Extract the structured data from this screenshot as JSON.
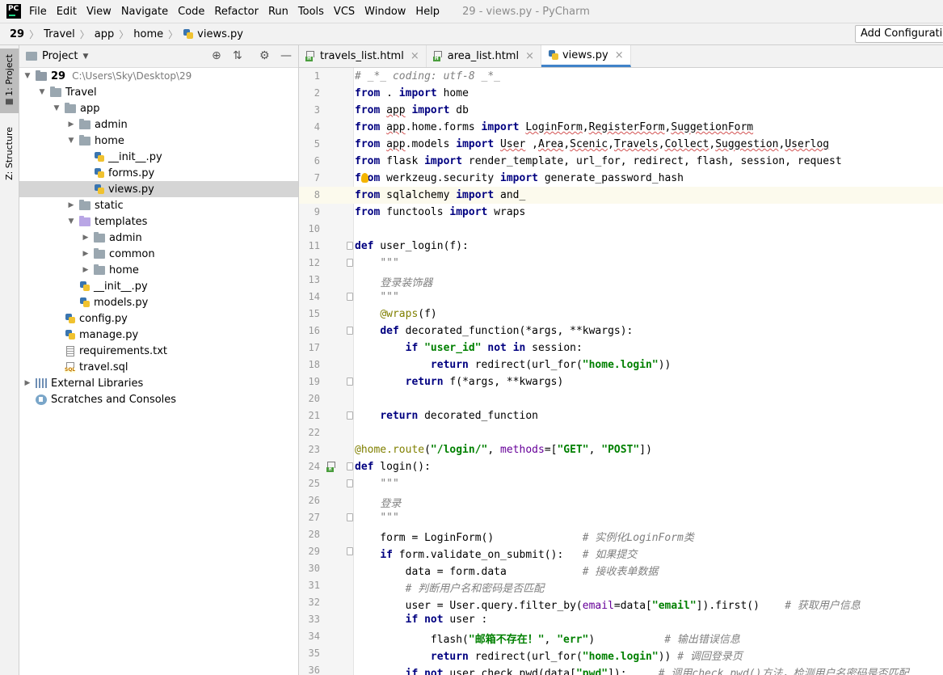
{
  "menubar": {
    "logo": "PC",
    "items": [
      "File",
      "Edit",
      "View",
      "Navigate",
      "Code",
      "Refactor",
      "Run",
      "Tools",
      "VCS",
      "Window",
      "Help"
    ],
    "window_title": "29 - views.py - PyCharm"
  },
  "breadcrumb": {
    "items": [
      "29",
      "Travel",
      "app",
      "home",
      "views.py"
    ],
    "run_config": "Add Configuration..."
  },
  "tool_strip": {
    "project_tab": "1: Project",
    "structure_tab": "Z: Structure"
  },
  "project_panel": {
    "title": "Project",
    "tree": [
      {
        "label": "29",
        "hint": "C:\\Users\\Sky\\Desktop\\29",
        "icon": "folder-icon",
        "arrow": "expanded",
        "depth": 0
      },
      {
        "label": "Travel",
        "icon": "folder-icon",
        "arrow": "expanded",
        "depth": 1
      },
      {
        "label": "app",
        "icon": "folder-icon",
        "arrow": "expanded",
        "depth": 2
      },
      {
        "label": "admin",
        "icon": "folder-icon",
        "arrow": "collapsed",
        "depth": 3
      },
      {
        "label": "home",
        "icon": "folder-icon",
        "arrow": "expanded",
        "depth": 3
      },
      {
        "label": "__init__.py",
        "icon": "python-file-icon",
        "arrow": "none",
        "depth": 4
      },
      {
        "label": "forms.py",
        "icon": "python-file-icon",
        "arrow": "none",
        "depth": 4
      },
      {
        "label": "views.py",
        "icon": "python-file-icon",
        "arrow": "none",
        "depth": 4,
        "selected": true
      },
      {
        "label": "static",
        "icon": "folder-icon",
        "arrow": "collapsed",
        "depth": 3
      },
      {
        "label": "templates",
        "icon": "templates-folder-icon",
        "arrow": "expanded",
        "depth": 3
      },
      {
        "label": "admin",
        "icon": "folder-icon",
        "arrow": "collapsed",
        "depth": 4
      },
      {
        "label": "common",
        "icon": "folder-icon",
        "arrow": "collapsed",
        "depth": 4
      },
      {
        "label": "home",
        "icon": "folder-icon",
        "arrow": "collapsed",
        "depth": 4
      },
      {
        "label": "__init__.py",
        "icon": "python-file-icon",
        "arrow": "none",
        "depth": 3
      },
      {
        "label": "models.py",
        "icon": "python-file-icon",
        "arrow": "none",
        "depth": 3
      },
      {
        "label": "config.py",
        "icon": "python-file-icon",
        "arrow": "none",
        "depth": 2
      },
      {
        "label": "manage.py",
        "icon": "python-file-icon",
        "arrow": "none",
        "depth": 2
      },
      {
        "label": "requirements.txt",
        "icon": "text-file-icon",
        "arrow": "none",
        "depth": 2
      },
      {
        "label": "travel.sql",
        "icon": "sql-file-icon",
        "arrow": "none",
        "depth": 2
      },
      {
        "label": "External Libraries",
        "icon": "libraries-icon",
        "arrow": "collapsed",
        "depth": 0
      },
      {
        "label": "Scratches and Consoles",
        "icon": "scratches-icon",
        "arrow": "none",
        "depth": 0
      }
    ]
  },
  "editor_tabs": [
    {
      "label": "travels_list.html",
      "icon": "html-file-icon",
      "active": false
    },
    {
      "label": "area_list.html",
      "icon": "html-file-icon",
      "active": false
    },
    {
      "label": "views.py",
      "icon": "python-file-icon",
      "active": true
    }
  ],
  "colors": {
    "keyword": "#000080",
    "string": "#008000",
    "comment": "#808080",
    "decorator": "#808000",
    "current_line": "#fcfaed",
    "selection": "#d5d5d5",
    "active_tab_underline": "#4083c9"
  },
  "code_lines": [
    [
      {
        "t": "# _*_ coding: utf-8 _*_",
        "c": "cm"
      }
    ],
    [
      {
        "t": "from",
        "c": "kw"
      },
      {
        "t": " . "
      },
      {
        "t": "import",
        "c": "kw"
      },
      {
        "t": " home"
      }
    ],
    [
      {
        "t": "from",
        "c": "kw"
      },
      {
        "t": " "
      },
      {
        "t": "app",
        "c": "wv"
      },
      {
        "t": " "
      },
      {
        "t": "import",
        "c": "kw"
      },
      {
        "t": " db"
      }
    ],
    [
      {
        "t": "from",
        "c": "kw"
      },
      {
        "t": " "
      },
      {
        "t": "app",
        "c": "wv"
      },
      {
        "t": ".home.forms "
      },
      {
        "t": "import",
        "c": "kw"
      },
      {
        "t": " "
      },
      {
        "t": "LoginForm",
        "c": "wv"
      },
      {
        "t": ","
      },
      {
        "t": "RegisterForm",
        "c": "wv"
      },
      {
        "t": ","
      },
      {
        "t": "SuggetionForm",
        "c": "wv"
      }
    ],
    [
      {
        "t": "from",
        "c": "kw"
      },
      {
        "t": " "
      },
      {
        "t": "app",
        "c": "wv"
      },
      {
        "t": ".models "
      },
      {
        "t": "import",
        "c": "kw"
      },
      {
        "t": " "
      },
      {
        "t": "User",
        "c": "wv"
      },
      {
        "t": " ,"
      },
      {
        "t": "Area",
        "c": "wv"
      },
      {
        "t": ","
      },
      {
        "t": "Scenic",
        "c": "wv"
      },
      {
        "t": ","
      },
      {
        "t": "Travels",
        "c": "wv"
      },
      {
        "t": ","
      },
      {
        "t": "Collect",
        "c": "wv"
      },
      {
        "t": ","
      },
      {
        "t": "Suggestion",
        "c": "wv"
      },
      {
        "t": ","
      },
      {
        "t": "Userlog",
        "c": "wv"
      }
    ],
    [
      {
        "t": "from",
        "c": "kw"
      },
      {
        "t": " flask "
      },
      {
        "t": "import",
        "c": "kw"
      },
      {
        "t": " render_template, url_for, redirect, flash, session, request"
      }
    ],
    [
      {
        "t": "from",
        "c": "kw"
      },
      {
        "t": " werkzeug.security "
      },
      {
        "t": "import",
        "c": "kw"
      },
      {
        "t": " generate_password_hash"
      }
    ],
    [
      {
        "t": "from",
        "c": "kw"
      },
      {
        "t": " sqlalchemy "
      },
      {
        "t": "import",
        "c": "kw"
      },
      {
        "t": " and_"
      }
    ],
    [
      {
        "t": "from",
        "c": "kw"
      },
      {
        "t": " functools "
      },
      {
        "t": "import",
        "c": "kw"
      },
      {
        "t": " wraps"
      }
    ],
    [],
    [
      {
        "t": "def",
        "c": "kw"
      },
      {
        "t": " user_login(f):"
      }
    ],
    [
      {
        "t": "    "
      },
      {
        "t": "\"\"\"",
        "c": "dc"
      }
    ],
    [
      {
        "t": "    "
      },
      {
        "t": "登录装饰器",
        "c": "dc"
      }
    ],
    [
      {
        "t": "    "
      },
      {
        "t": "\"\"\"",
        "c": "dc"
      }
    ],
    [
      {
        "t": "    "
      },
      {
        "t": "@wraps",
        "c": "de"
      },
      {
        "t": "(f)"
      }
    ],
    [
      {
        "t": "    "
      },
      {
        "t": "def",
        "c": "kw"
      },
      {
        "t": " decorated_function(*args, **kwargs):"
      }
    ],
    [
      {
        "t": "        "
      },
      {
        "t": "if",
        "c": "kw"
      },
      {
        "t": " "
      },
      {
        "t": "\"user_id\"",
        "c": "st"
      },
      {
        "t": " "
      },
      {
        "t": "not in",
        "c": "kw"
      },
      {
        "t": " session:"
      }
    ],
    [
      {
        "t": "            "
      },
      {
        "t": "return",
        "c": "kw"
      },
      {
        "t": " redirect(url_for("
      },
      {
        "t": "\"home.login\"",
        "c": "st"
      },
      {
        "t": "))"
      }
    ],
    [
      {
        "t": "        "
      },
      {
        "t": "return",
        "c": "kw"
      },
      {
        "t": " f(*args, **kwargs)"
      }
    ],
    [],
    [
      {
        "t": "    "
      },
      {
        "t": "return",
        "c": "kw"
      },
      {
        "t": " decorated_function"
      }
    ],
    [],
    [
      {
        "t": "@home.route",
        "c": "de"
      },
      {
        "t": "("
      },
      {
        "t": "\"/login/\"",
        "c": "st"
      },
      {
        "t": ", "
      },
      {
        "t": "methods",
        "c": "pa"
      },
      {
        "t": "=["
      },
      {
        "t": "\"GET\"",
        "c": "st"
      },
      {
        "t": ", "
      },
      {
        "t": "\"POST\"",
        "c": "st"
      },
      {
        "t": "])"
      }
    ],
    [
      {
        "t": "def",
        "c": "kw"
      },
      {
        "t": " login():"
      }
    ],
    [
      {
        "t": "    "
      },
      {
        "t": "\"\"\"",
        "c": "dc"
      }
    ],
    [
      {
        "t": "    "
      },
      {
        "t": "登录",
        "c": "dc"
      }
    ],
    [
      {
        "t": "    "
      },
      {
        "t": "\"\"\"",
        "c": "dc"
      }
    ],
    [
      {
        "t": "    form = LoginForm()              "
      },
      {
        "t": "# 实例化LoginForm类",
        "c": "cs"
      }
    ],
    [
      {
        "t": "    "
      },
      {
        "t": "if",
        "c": "kw"
      },
      {
        "t": " form.validate_on_submit():   "
      },
      {
        "t": "# 如果提交",
        "c": "cs"
      }
    ],
    [
      {
        "t": "        data = form.data            "
      },
      {
        "t": "# 接收表单数据",
        "c": "cs"
      }
    ],
    [
      {
        "t": "        "
      },
      {
        "t": "# 判断用户名和密码是否匹配",
        "c": "cs"
      }
    ],
    [
      {
        "t": "        user = User.query.filter_by("
      },
      {
        "t": "email",
        "c": "pa"
      },
      {
        "t": "=data["
      },
      {
        "t": "\"email\"",
        "c": "st"
      },
      {
        "t": "]).first()    "
      },
      {
        "t": "# 获取用户信息",
        "c": "cs"
      }
    ],
    [
      {
        "t": "        "
      },
      {
        "t": "if not",
        "c": "kw"
      },
      {
        "t": " user :"
      }
    ],
    [
      {
        "t": "            flash("
      },
      {
        "t": "\"邮箱不存在！\"",
        "c": "st"
      },
      {
        "t": ", "
      },
      {
        "t": "\"err\"",
        "c": "st"
      },
      {
        "t": ")           "
      },
      {
        "t": "# 输出错误信息",
        "c": "cs"
      }
    ],
    [
      {
        "t": "            "
      },
      {
        "t": "return",
        "c": "kw"
      },
      {
        "t": " redirect(url_for("
      },
      {
        "t": "\"home.login\"",
        "c": "st"
      },
      {
        "t": ")) "
      },
      {
        "t": "# 调回登录页",
        "c": "cs"
      }
    ],
    [
      {
        "t": "        "
      },
      {
        "t": "if not",
        "c": "kw"
      },
      {
        "t": " user.check_pwd(data["
      },
      {
        "t": "\"pwd\"",
        "c": "st"
      },
      {
        "t": "]):     "
      },
      {
        "t": "# 调用check_pwd()方法，检测用户名密码是否匹配",
        "c": "cs"
      }
    ]
  ],
  "code_meta": {
    "current_line": 8,
    "bulb_line": 7,
    "gutter_html_line": 24,
    "fold_lines": [
      11,
      12,
      14,
      16,
      19,
      21,
      24,
      25,
      27,
      29
    ]
  }
}
